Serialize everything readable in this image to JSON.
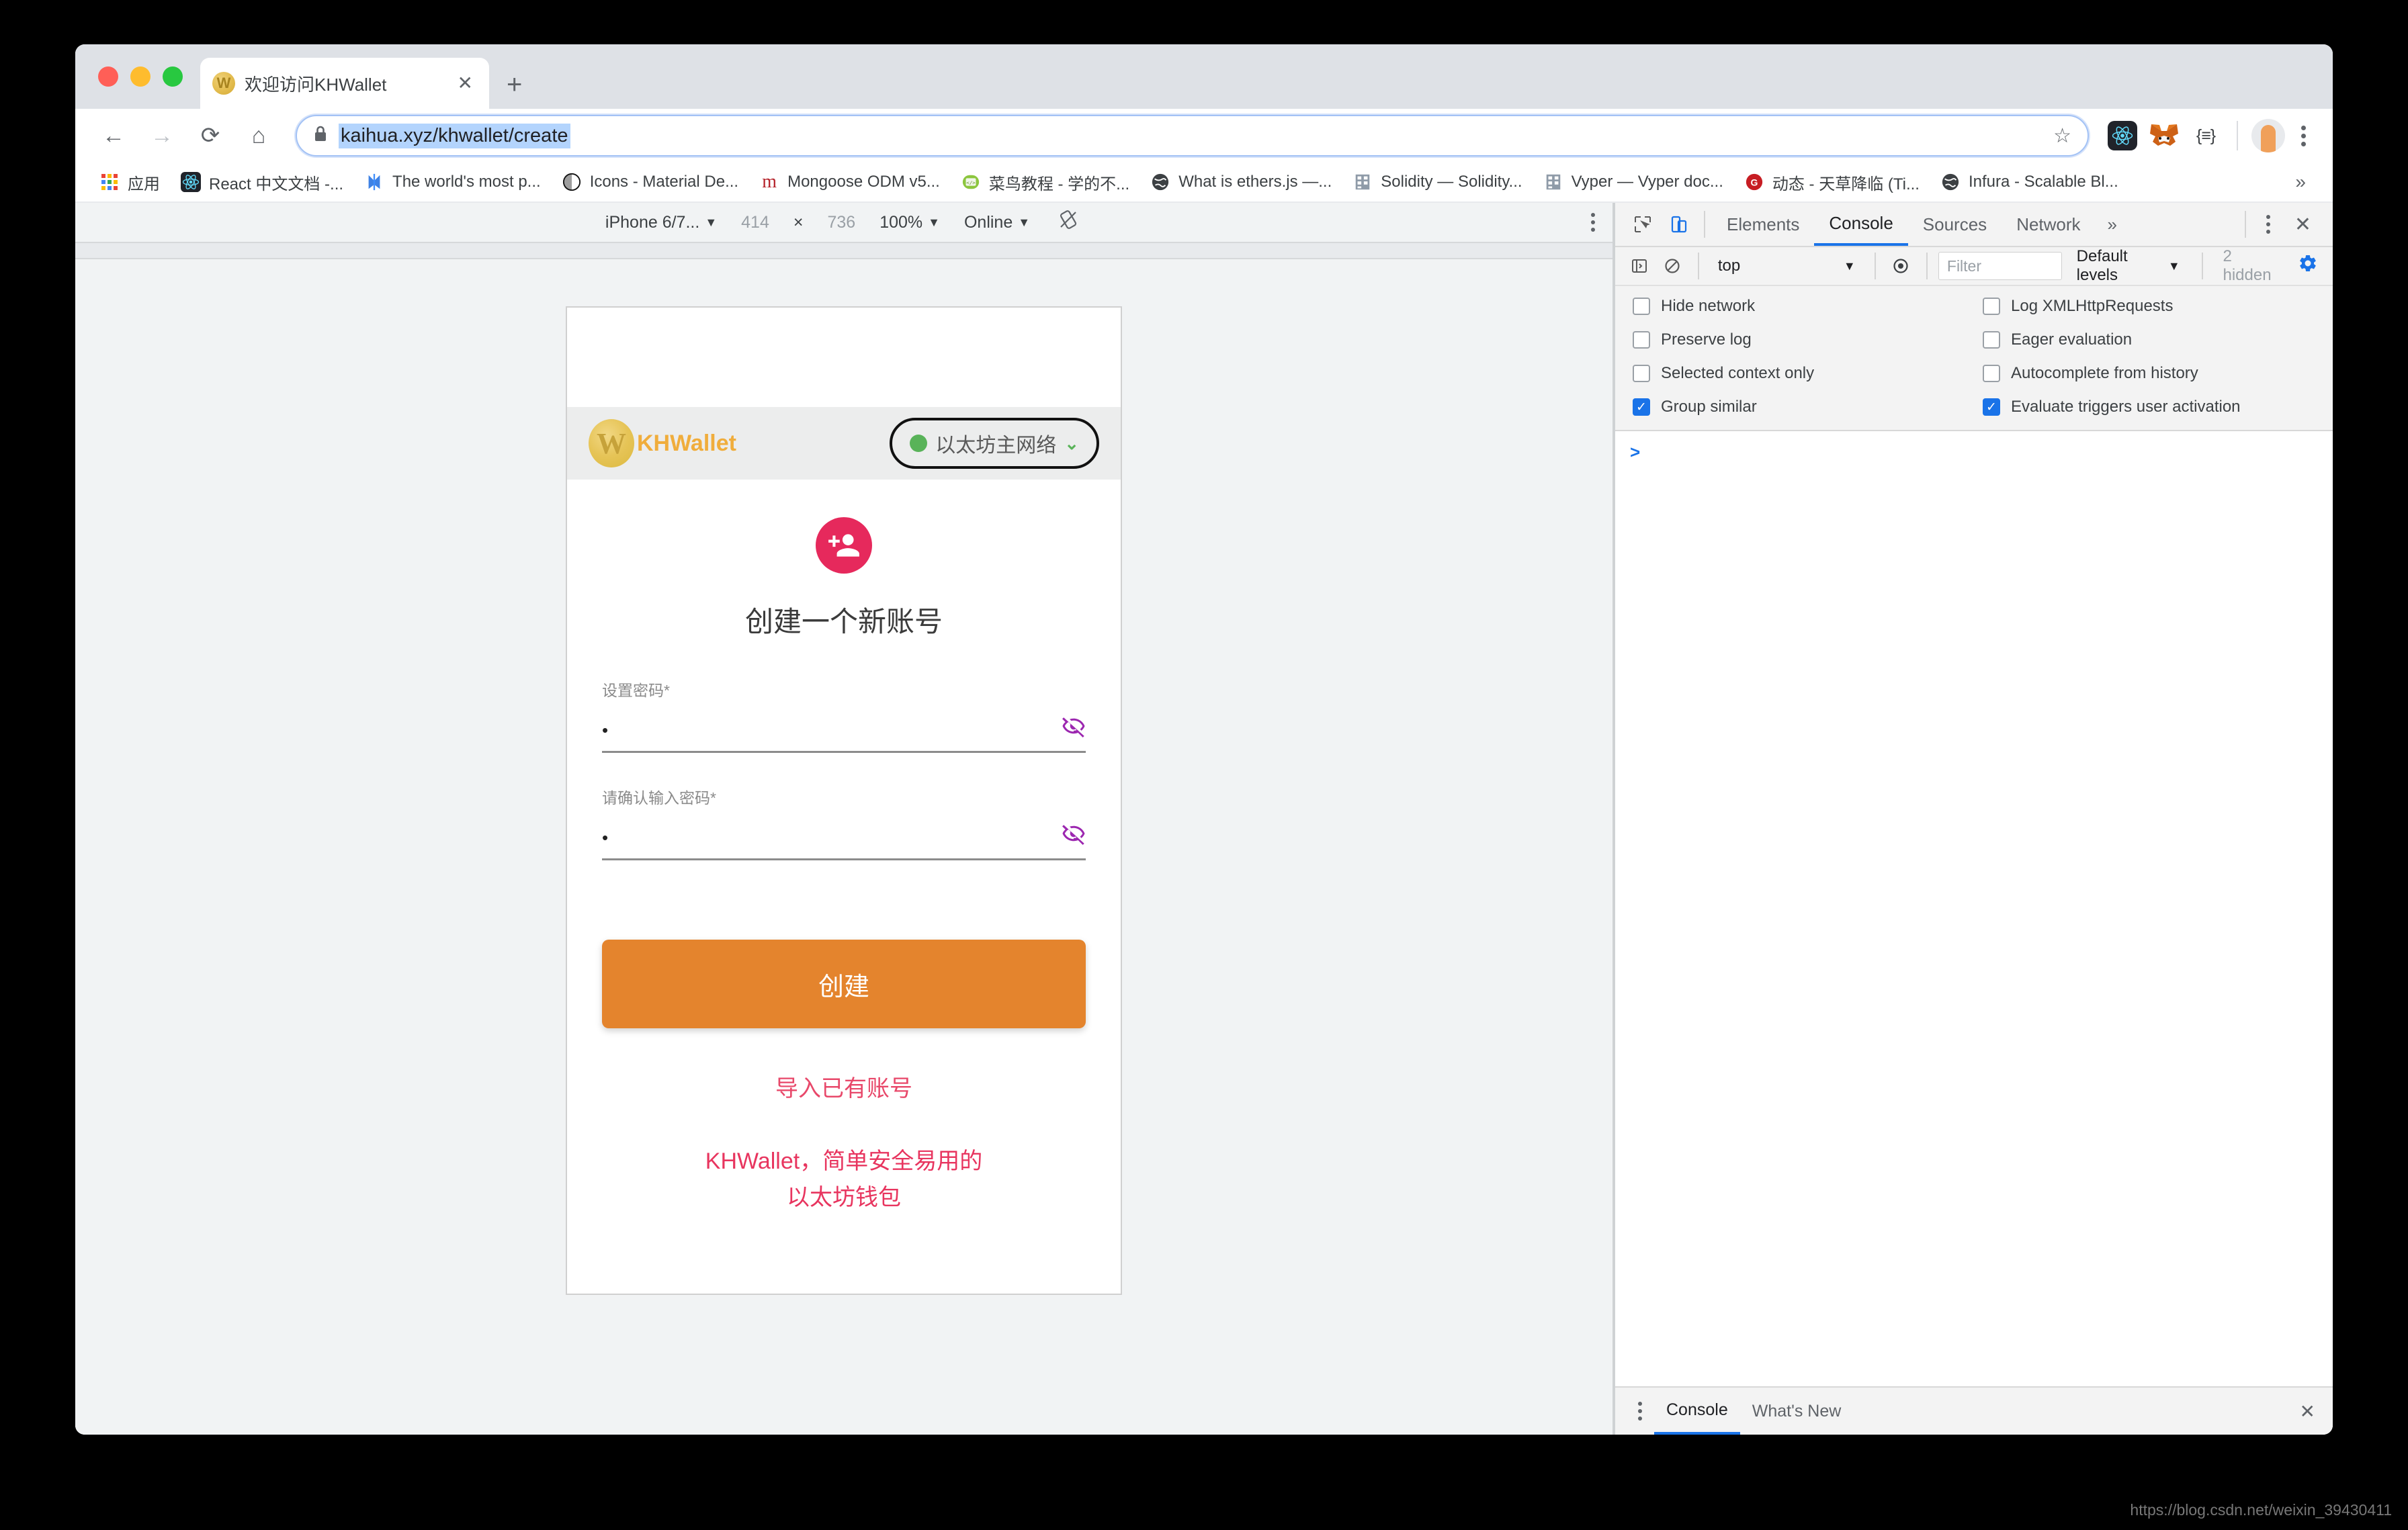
{
  "browser": {
    "tab": {
      "title": "欢迎访问KHWallet",
      "favicon": "khwallet-favicon",
      "close": "✕"
    },
    "new_tab": "+",
    "nav": {
      "back": "←",
      "forward": "→",
      "reload": "⟳",
      "home": "⌂"
    },
    "omnibox": {
      "lock": "🔒",
      "url": "kaihua.xyz/khwallet/create",
      "star": "☆"
    },
    "extensions": [
      {
        "name": "react-devtools-extension",
        "glyph": "⚛"
      },
      {
        "name": "metamask-extension",
        "glyph": "🦊"
      },
      {
        "name": "json-formatter-extension",
        "glyph": "{≡}"
      }
    ],
    "bookmarks_label": "应用",
    "bookmarks": [
      {
        "label": "React 中文文档 -...",
        "icon": "react-icon"
      },
      {
        "label": "The world's most p...",
        "icon": "mongodb-compass-icon"
      },
      {
        "label": "Icons - Material De...",
        "icon": "material-design-icon"
      },
      {
        "label": "Mongoose ODM v5...",
        "icon": "mongoose-icon"
      },
      {
        "label": "菜鸟教程 - 学的不...",
        "icon": "runoob-icon"
      },
      {
        "label": "What is ethers.js —...",
        "icon": "globe-icon"
      },
      {
        "label": "Solidity — Solidity...",
        "icon": "solidity-icon"
      },
      {
        "label": "Vyper — Vyper doc...",
        "icon": "vyper-icon"
      },
      {
        "label": "动态 - 天草降临 (Ti...",
        "icon": "gitee-icon"
      },
      {
        "label": "Infura - Scalable Bl...",
        "icon": "globe-icon"
      }
    ],
    "bookmarks_overflow": "»"
  },
  "device_toolbar": {
    "device": "iPhone 6/7...",
    "width": "414",
    "separator": "×",
    "height": "736",
    "zoom": "100%",
    "throttling": "Online",
    "rotate_icon": "rotate-icon",
    "caret": "▼"
  },
  "app": {
    "brand": {
      "logo": "W",
      "name": "KHWallet"
    },
    "network": {
      "label": "以太坊主网络",
      "status_color": "#59b359",
      "caret": "⌄"
    },
    "avatar_icon": "person-add-icon",
    "heading": "创建一个新账号",
    "fields": [
      {
        "label": "设置密码",
        "required": "*",
        "value": "•",
        "toggle": "eye-off-icon"
      },
      {
        "label": "请确认输入密码",
        "required": "*",
        "value": "•",
        "toggle": "eye-off-icon"
      }
    ],
    "create_button": "创建",
    "import_link": "导入已有账号",
    "tagline_line1": "KHWallet，简单安全易用的",
    "tagline_line2": "以太坊钱包",
    "accent_orange": "#e4842d",
    "accent_pink": "#e8355f",
    "accent_gold": "#f0ad3c",
    "accent_purple": "#9c27b0"
  },
  "devtools": {
    "inspect_icon": "inspect-icon",
    "device_toggle_icon": "device-toolbar-icon",
    "tabs": [
      {
        "label": "Elements",
        "active": false
      },
      {
        "label": "Console",
        "active": true
      },
      {
        "label": "Sources",
        "active": false
      },
      {
        "label": "Network",
        "active": false
      }
    ],
    "more_tabs": "»",
    "close": "✕",
    "console_filter": {
      "sidebar_icon": "console-sidebar-icon",
      "clear_icon": "clear-console-icon",
      "context": "top",
      "caret": "▼",
      "eye_icon": "live-expression-icon",
      "filter_placeholder": "Filter",
      "levels": "Default levels",
      "hidden": "2 hidden",
      "settings_icon": "gear-icon"
    },
    "settings_options": [
      {
        "label": "Hide network",
        "checked": false
      },
      {
        "label": "Log XMLHttpRequests",
        "checked": false
      },
      {
        "label": "Preserve log",
        "checked": false
      },
      {
        "label": "Eager evaluation",
        "checked": false
      },
      {
        "label": "Selected context only",
        "checked": false
      },
      {
        "label": "Autocomplete from history",
        "checked": false
      },
      {
        "label": "Group similar",
        "checked": true
      },
      {
        "label": "Evaluate triggers user activation",
        "checked": true
      }
    ],
    "prompt": ">",
    "drawer_tabs": [
      {
        "label": "Console",
        "active": true
      },
      {
        "label": "What's New",
        "active": false
      }
    ],
    "drawer_close": "✕"
  },
  "watermark": "https://blog.csdn.net/weixin_39430411"
}
